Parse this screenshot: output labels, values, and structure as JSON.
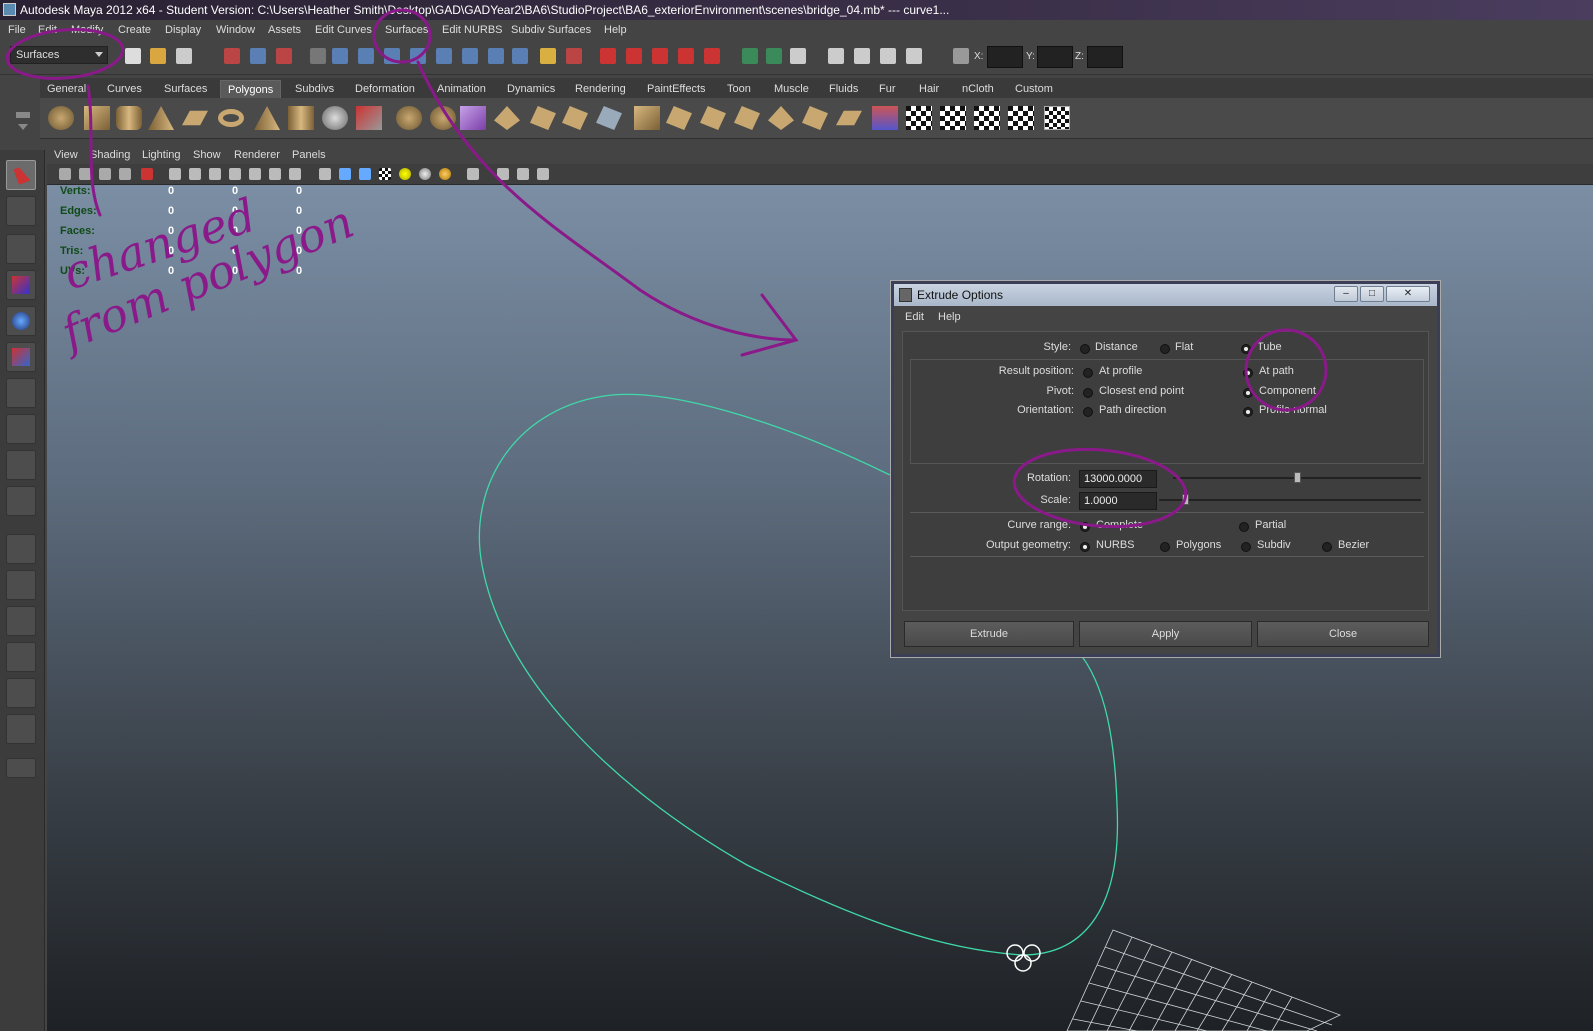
{
  "window": {
    "title": "Autodesk Maya 2012 x64 - Student Version: C:\\Users\\Heather Smith\\Desktop\\GAD\\GADYear2\\BA6\\StudioProject\\BA6_exteriorEnvironment\\scenes\\bridge_04.mb*   ---   curve1..."
  },
  "menubar": [
    "File",
    "Edit",
    "Modify",
    "Create",
    "Display",
    "Window",
    "Assets",
    "Edit Curves",
    "Surfaces",
    "Edit NURBS",
    "Subdiv Surfaces",
    "Help"
  ],
  "statusline": {
    "mode": "Surfaces",
    "x_label": "X:",
    "y_label": "Y:",
    "z_label": "Z:"
  },
  "shelf_tabs": {
    "items": [
      "General",
      "Curves",
      "Surfaces",
      "Polygons",
      "Subdivs",
      "Deformation",
      "Animation",
      "Dynamics",
      "Rendering",
      "PaintEffects",
      "Toon",
      "Muscle",
      "Fluids",
      "Fur",
      "Hair",
      "nCloth",
      "Custom"
    ],
    "active": "Polygons"
  },
  "panel_menu": [
    "View",
    "Shading",
    "Lighting",
    "Show",
    "Renderer",
    "Panels"
  ],
  "hud": {
    "rows": [
      {
        "label": "Verts:",
        "v1": "0",
        "v2": "0",
        "v3": "0"
      },
      {
        "label": "Edges:",
        "v1": "0",
        "v2": "0",
        "v3": "0"
      },
      {
        "label": "Faces:",
        "v1": "0",
        "v2": "0",
        "v3": "0"
      },
      {
        "label": "Tris:",
        "v1": "0",
        "v2": "0",
        "v3": "0"
      },
      {
        "label": "UVs:",
        "v1": "0",
        "v2": "0",
        "v3": "0"
      }
    ]
  },
  "dialog": {
    "title": "Extrude Options",
    "menu": [
      "Edit",
      "Help"
    ],
    "style": {
      "label": "Style:",
      "options": [
        "Distance",
        "Flat",
        "Tube"
      ],
      "selected": "Tube"
    },
    "result_position": {
      "label": "Result position:",
      "options": [
        "At profile",
        "At path"
      ],
      "selected": "At path"
    },
    "pivot": {
      "label": "Pivot:",
      "options": [
        "Closest end point",
        "Component"
      ],
      "selected": "Component"
    },
    "orientation": {
      "label": "Orientation:",
      "options": [
        "Path direction",
        "Profile normal"
      ],
      "selected": "Profile normal"
    },
    "rotation": {
      "label": "Rotation:",
      "value": "13000.0000",
      "slider_fraction": 0.5
    },
    "scale": {
      "label": "Scale:",
      "value": "1.0000",
      "slider_fraction": 0.1
    },
    "curve_range": {
      "label": "Curve range:",
      "options": [
        "Complete",
        "Partial"
      ],
      "selected": "Complete"
    },
    "output_geometry": {
      "label": "Output geometry:",
      "options": [
        "NURBS",
        "Polygons",
        "Subdiv",
        "Bezier"
      ],
      "selected": "NURBS"
    },
    "buttons": {
      "extrude": "Extrude",
      "apply": "Apply",
      "close": "Close"
    }
  },
  "annotation": {
    "line1": "changed",
    "line2": "from polygon",
    "color": "#8a1a8a"
  },
  "colors": {
    "curve": "#3fd9a8",
    "viewport_top": "#7b8ea4",
    "viewport_bottom": "#1e2125"
  }
}
